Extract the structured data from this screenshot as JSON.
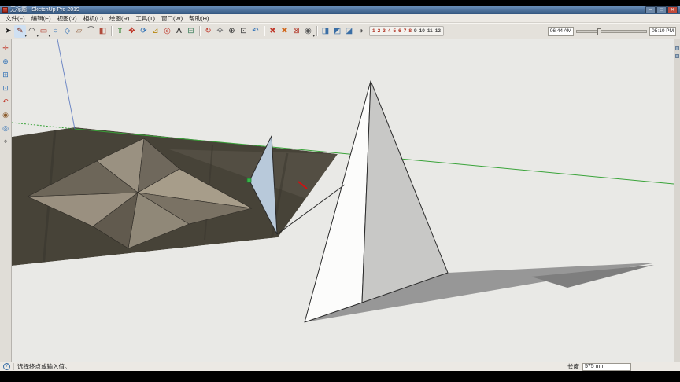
{
  "colors": {
    "ground": "#e9e9e6",
    "edge": "#2b2b2b",
    "axis-green": "#39a339",
    "axis-blue": "#5a78c0",
    "shadow": "#979797",
    "shadow-dark": "#7e7e7e",
    "triangle-blue": "#b8c9da",
    "titlebar-top": "#6f93bd",
    "titlebar-bottom": "#33567f",
    "toolbar-bg": "#e4e1db",
    "statusbar-bg": "#ece9e4"
  },
  "window": {
    "title": "无标题 - SketchUp Pro 2019",
    "controls": [
      {
        "name": "minimize-button",
        "glyph": "─",
        "bg": "#6d88a8"
      },
      {
        "name": "maximize-button",
        "glyph": "□",
        "bg": "#6d88a8"
      },
      {
        "name": "close-button",
        "glyph": "✕",
        "bg": "#c14a3a"
      }
    ]
  },
  "menubar": {
    "items": [
      {
        "name": "menu-file",
        "label": "文件(F)"
      },
      {
        "name": "menu-edit",
        "label": "编辑(E)"
      },
      {
        "name": "menu-view",
        "label": "视图(V)"
      },
      {
        "name": "menu-camera",
        "label": "相机(C)"
      },
      {
        "name": "menu-draw",
        "label": "绘图(R)"
      },
      {
        "name": "menu-tools",
        "label": "工具(T)"
      },
      {
        "name": "menu-window",
        "label": "窗口(W)"
      },
      {
        "name": "menu-help",
        "label": "帮助(H)"
      }
    ]
  },
  "toolbar": {
    "group_draw": [
      {
        "name": "select-tool",
        "glyph": "➤",
        "color": "#1a1a1a"
      },
      {
        "name": "line-tool",
        "glyph": "✎",
        "color": "#7a2a1a",
        "caret": "▾",
        "bg": "#cfe0f2"
      },
      {
        "name": "arc-tool",
        "glyph": "◠",
        "color": "#444444",
        "caret": "▾"
      },
      {
        "name": "rectangle-tool",
        "glyph": "▭",
        "color": "#b03020",
        "caret": "▾"
      },
      {
        "name": "circle-tool",
        "glyph": "○",
        "color": "#2a6db5"
      },
      {
        "name": "polygon-tool",
        "glyph": "◇",
        "color": "#2a6db5"
      },
      {
        "name": "eraser-tool",
        "glyph": "▱",
        "color": "#9a6a4a"
      },
      {
        "name": "tape-measure-tool",
        "glyph": "⌒",
        "color": "#555555"
      },
      {
        "name": "paint-bucket-tool",
        "glyph": "◧",
        "color": "#b04a3a"
      }
    ],
    "group_edit": [
      {
        "name": "pushpull-tool",
        "glyph": "⇧",
        "color": "#2a7d2a"
      },
      {
        "name": "move-tool",
        "glyph": "✥",
        "color": "#c0392b"
      },
      {
        "name": "rotate-tool",
        "glyph": "⟳",
        "color": "#2a6db5"
      },
      {
        "name": "scale-tool",
        "glyph": "⊿",
        "color": "#b8860b"
      },
      {
        "name": "offset-tool",
        "glyph": "◎",
        "color": "#c0392b"
      },
      {
        "name": "text-tool",
        "glyph": "A",
        "color": "#222222"
      },
      {
        "name": "section-plane-tool",
        "glyph": "⊟",
        "color": "#3a7d5a"
      }
    ],
    "group_camera": [
      {
        "name": "orbit-tool",
        "glyph": "↻",
        "color": "#c0392b"
      },
      {
        "name": "pan-tool",
        "glyph": "✥",
        "color": "#8a8a8a"
      },
      {
        "name": "zoom-tool",
        "glyph": "⊕",
        "color": "#333333"
      },
      {
        "name": "zoom-extents-tool",
        "glyph": "⊡",
        "color": "#333333"
      },
      {
        "name": "previous-view-tool",
        "glyph": "↶",
        "color": "#2a6db5"
      }
    ],
    "group_misc": [
      {
        "name": "delete-guides-icon",
        "glyph": "✖",
        "color": "#c0392b"
      },
      {
        "name": "hide-geometry-icon",
        "glyph": "✖",
        "color": "#d2691e"
      },
      {
        "name": "match-photo-icon",
        "glyph": "⊠",
        "color": "#b03020"
      },
      {
        "name": "add-location-icon",
        "glyph": "◉",
        "color": "#555555",
        "caret": "▾"
      }
    ],
    "group_views": [
      {
        "name": "view-front-icon",
        "glyph": "◨",
        "color": "#3a6ea5"
      },
      {
        "name": "view-iso-icon",
        "glyph": "◩",
        "color": "#3a6ea5"
      },
      {
        "name": "view-top-icon",
        "glyph": "◪",
        "color": "#3a6ea5"
      },
      {
        "name": "shadows-toggle-icon",
        "glyph": "◑",
        "color": "#555555"
      }
    ],
    "scene_tabs": [
      {
        "name": "scene-tab-1",
        "label": "1",
        "color": "#b03020"
      },
      {
        "name": "scene-tab-2",
        "label": "2",
        "color": "#b03020"
      },
      {
        "name": "scene-tab-3",
        "label": "3",
        "color": "#b03020"
      },
      {
        "name": "scene-tab-4",
        "label": "4",
        "color": "#b03020"
      },
      {
        "name": "scene-tab-5",
        "label": "5",
        "color": "#b03020"
      },
      {
        "name": "scene-tab-6",
        "label": "6",
        "color": "#b03020"
      },
      {
        "name": "scene-tab-7",
        "label": "7",
        "color": "#b03020"
      },
      {
        "name": "scene-tab-8",
        "label": "8",
        "color": "#b03020"
      },
      {
        "name": "scene-tab-9",
        "label": "9",
        "color": "#444444"
      },
      {
        "name": "scene-tab-10",
        "label": "10",
        "color": "#444444"
      },
      {
        "name": "scene-tab-11",
        "label": "11",
        "color": "#444444"
      },
      {
        "name": "scene-tab-12",
        "label": "12",
        "color": "#444444"
      }
    ],
    "shadows": {
      "start_time": "06:44 AM",
      "end_time": "05:10 PM"
    }
  },
  "left_toolbar": {
    "items": [
      {
        "name": "axes-tool",
        "glyph": "✛",
        "color": "#c0392b"
      },
      {
        "name": "zoom-tool-left",
        "glyph": "⊕",
        "color": "#2a6db5"
      },
      {
        "name": "zoom-window-tool",
        "glyph": "⊞",
        "color": "#2a6db5"
      },
      {
        "name": "zoom-extents-tool-left",
        "glyph": "⊡",
        "color": "#2a6db5"
      },
      {
        "name": "previous-view-tool-left",
        "glyph": "↶",
        "color": "#c0392b"
      },
      {
        "name": "position-camera-tool",
        "glyph": "◉",
        "color": "#8a5a2a"
      },
      {
        "name": "look-around-tool",
        "glyph": "◎",
        "color": "#2a6db5"
      },
      {
        "name": "walk-tool",
        "glyph": "⌖",
        "color": "#333333"
      }
    ]
  },
  "tray": {
    "items": [
      {
        "name": "tray-toggle-1"
      },
      {
        "name": "tray-toggle-2"
      }
    ]
  },
  "statusbar": {
    "help_glyph": "?",
    "hint": "选择终点或输入值。",
    "measure_label": "长度",
    "measure_value": "575 mm"
  }
}
